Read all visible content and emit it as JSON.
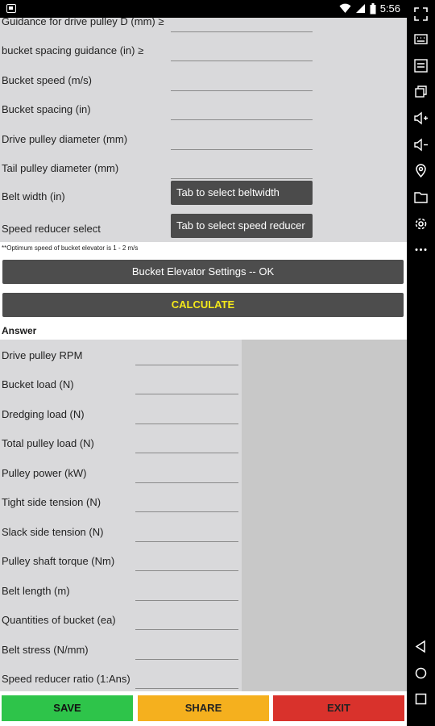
{
  "status_bar": {
    "time": "5:56"
  },
  "inputs": [
    {
      "label": "Guidance for drive pulley D (mm) ≥",
      "value": ""
    },
    {
      "label": "bucket spacing guidance (in) ≥",
      "value": ""
    },
    {
      "label": "Bucket speed (m/s)",
      "value": ""
    },
    {
      "label": "Bucket spacing (in)",
      "value": ""
    },
    {
      "label": "Drive pulley diameter (mm)",
      "value": ""
    },
    {
      "label": "Tail pulley diameter (mm)",
      "value": ""
    }
  ],
  "belt_width": {
    "label": "Belt width (in)",
    "button": "Tab to select beltwidth"
  },
  "speed_reducer": {
    "label": "Speed reducer select",
    "button": "Tab to select speed reducer"
  },
  "note": "**Optimum speed of bucket elevator is 1 - 2 m/s",
  "settings_button": "Bucket Elevator Settings -- OK",
  "calculate_button": "CALCULATE",
  "answer_title": "Answer",
  "outputs": [
    {
      "label": "Drive pulley RPM",
      "value": ""
    },
    {
      "label": "Bucket load (N)",
      "value": ""
    },
    {
      "label": "Dredging load (N)",
      "value": ""
    },
    {
      "label": "Total pulley load (N)",
      "value": ""
    },
    {
      "label": "Pulley power (kW)",
      "value": ""
    },
    {
      "label": "Tight side tension (N)",
      "value": ""
    },
    {
      "label": "Slack side tension (N)",
      "value": ""
    },
    {
      "label": "Pulley shaft torque (Nm)",
      "value": ""
    },
    {
      "label": "Belt length (m)",
      "value": ""
    },
    {
      "label": "Quantities of bucket (ea)",
      "value": ""
    },
    {
      "label": "Belt stress (N/mm)",
      "value": ""
    },
    {
      "label": "Speed reducer ratio (1:Ans)",
      "value": ""
    }
  ],
  "bottom_buttons": {
    "save": "SAVE",
    "share": "SHARE",
    "exit": "EXIT"
  },
  "colors": {
    "save": "#2ec44a",
    "share": "#f5b01e",
    "exit": "#d9322c",
    "calculate_text": "#f5e91a"
  }
}
